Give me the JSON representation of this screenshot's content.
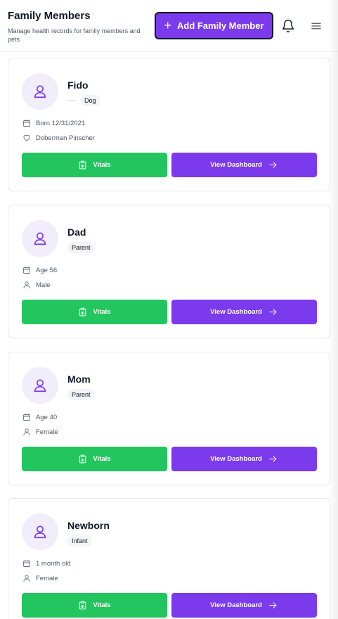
{
  "header": {
    "title": "Family Members",
    "subtitle": "Manage health records for family members and pets",
    "add_button_label": "Add Family Member"
  },
  "icons": {
    "add": "plus-icon",
    "notifications": "bell-icon",
    "menu": "hamburger-menu-icon",
    "avatar": "user-icon",
    "born": "calendar-icon",
    "breed": "heart-icon",
    "gender": "user-icon",
    "vitals": "clipboard-icon",
    "dashboard": "arrow-right-icon"
  },
  "colors": {
    "primary": "#7c3aed",
    "success": "#22c55e",
    "avatar_bg": "#f1edfb"
  },
  "members": [
    {
      "name": "Fido",
      "badge": "Dog",
      "info1": "Born 12/31/2021",
      "info2": "Doberman Pinscher",
      "vitals_label": "Vitals",
      "dashboard_label": "View Dashboard"
    },
    {
      "name": "Dad",
      "badge": "Parent",
      "info1": "Age 56",
      "info2": "Male",
      "vitals_label": "Vitals",
      "dashboard_label": "View Dashboard"
    },
    {
      "name": "Mom",
      "badge": "Parent",
      "info1": "Age 40",
      "info2": "Female",
      "vitals_label": "Vitals",
      "dashboard_label": "View Dashboard"
    },
    {
      "name": "Newborn",
      "badge": "Infant",
      "info1": "1 month old",
      "info2": "Female",
      "vitals_label": "Vitals",
      "dashboard_label": "View Dashboard"
    }
  ]
}
